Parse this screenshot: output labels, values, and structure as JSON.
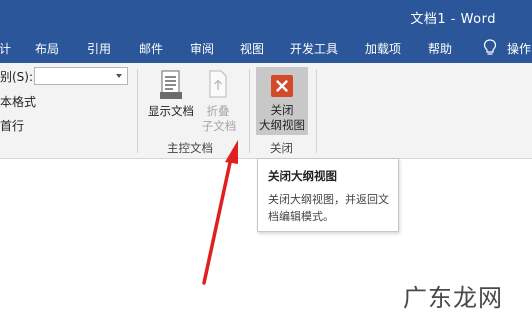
{
  "window": {
    "title": "文档1  -  Word"
  },
  "tabs": [
    {
      "label": "计"
    },
    {
      "label": "布局"
    },
    {
      "label": "引用"
    },
    {
      "label": "邮件"
    },
    {
      "label": "审阅"
    },
    {
      "label": "视图"
    },
    {
      "label": "开发工具"
    },
    {
      "label": "加载项"
    },
    {
      "label": "帮助"
    },
    {
      "label": "操作"
    }
  ],
  "ribbon": {
    "outline_tools": {
      "level_label": "别(S):",
      "level_value": "",
      "format_label": "本格式",
      "first_line_label": "首行"
    },
    "master_document": {
      "show_document": "显示文档",
      "collapse_subdocs_line1": "折叠",
      "collapse_subdocs_line2": "子文档",
      "group_label": "主控文档"
    },
    "close": {
      "button_line1": "关闭",
      "button_line2": "大纲视图",
      "group_label": "关闭"
    }
  },
  "tooltip": {
    "title": "关闭大纲视图",
    "body": "关闭大纲视图，并返回文档编辑模式。"
  },
  "watermark": {
    "text": "广东龙网"
  },
  "colors": {
    "title_bar": "#2b579a",
    "ribbon_bg": "#f3f3f3",
    "close_icon": "#d04a2b",
    "arrow": "#e02020"
  }
}
